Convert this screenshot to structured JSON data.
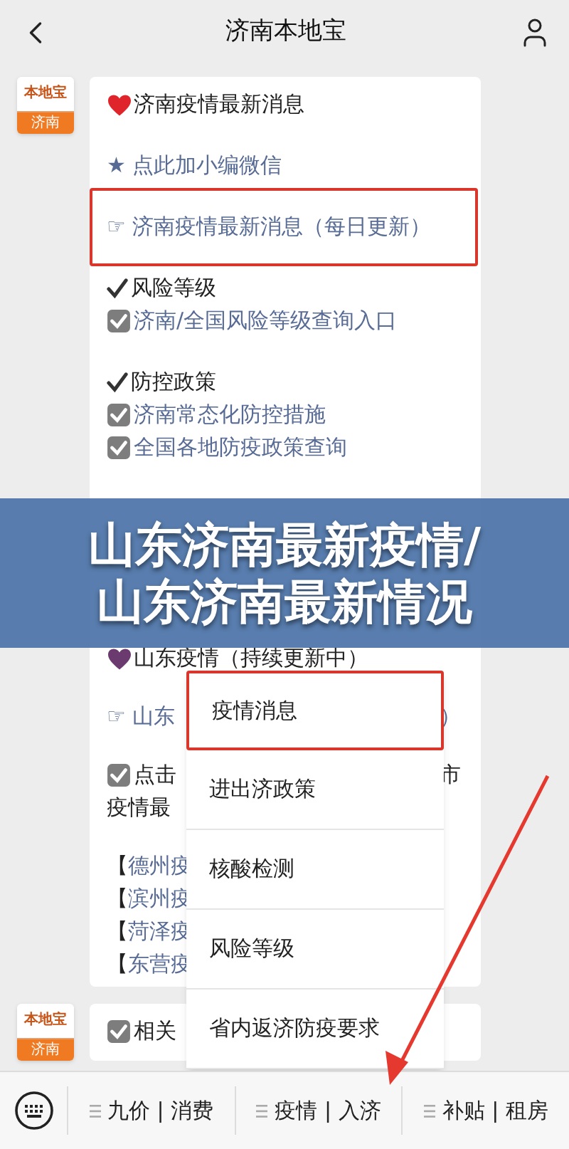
{
  "header": {
    "title": "济南本地宝"
  },
  "messages": [
    {
      "avatar": {
        "brand": "本地宝",
        "city": "济南"
      },
      "sections": [
        {
          "groups": [
            [
              {
                "kind": "heart-title",
                "color": "#e0242b",
                "text": "济南疫情最新消息"
              }
            ],
            [
              {
                "kind": "link",
                "text": "★ 点此加小编微信"
              }
            ],
            [
              {
                "kind": "link",
                "text": "☞ 济南疫情最新消息（每日更新）",
                "highlighted": true
              }
            ],
            [
              {
                "kind": "check-title",
                "text": "风险等级"
              },
              {
                "kind": "checkbox-link",
                "text": "济南/全国风险等级查询入口"
              }
            ],
            [
              {
                "kind": "check-title",
                "text": "防控政策"
              },
              {
                "kind": "checkbox-link",
                "text": "济南常态化防控措施"
              },
              {
                "kind": "checkbox-link",
                "text": "全国各地防疫政策查询"
              }
            ]
          ]
        },
        {
          "groups": [
            [
              {
                "kind": "heart-title",
                "color": "#6b3a6e",
                "text": "山东疫情（持续更新中）"
              }
            ],
            [
              {
                "kind": "link",
                "text": "☞ 山东",
                "tail": "）"
              }
            ],
            [
              {
                "kind": "checkbox-title",
                "text": "点击",
                "tail": "市"
              },
              {
                "kind": "title",
                "text": "疫情最"
              }
            ],
            [
              {
                "kind": "bracket-link",
                "prefix": "【",
                "text": "德州疫"
              },
              {
                "kind": "bracket-link",
                "prefix": "【",
                "text": "滨州疫"
              },
              {
                "kind": "bracket-link",
                "prefix": "【",
                "text": "菏泽疫"
              },
              {
                "kind": "bracket-link",
                "prefix": "【",
                "text": "东营疫"
              }
            ]
          ]
        }
      ]
    },
    {
      "avatar": {
        "brand": "本地宝",
        "city": "济南"
      },
      "sections": [
        {
          "groups": [
            [
              {
                "kind": "checkbox-title",
                "text": "相关"
              }
            ]
          ]
        }
      ]
    }
  ],
  "banner": {
    "lines": [
      "山东济南最新疫情/",
      "山东济南最新情况"
    ]
  },
  "popup_menu": [
    {
      "label": "疫情消息",
      "highlighted": true
    },
    {
      "label": "进出济政策",
      "highlighted": false
    },
    {
      "label": "核酸检测",
      "highlighted": false
    },
    {
      "label": "风险等级",
      "highlighted": false
    },
    {
      "label": "省内返济防疫要求",
      "highlighted": false
    }
  ],
  "bottom_menu": [
    "九价 | 消费",
    "疫情 | 入济",
    "补贴 | 租房"
  ]
}
